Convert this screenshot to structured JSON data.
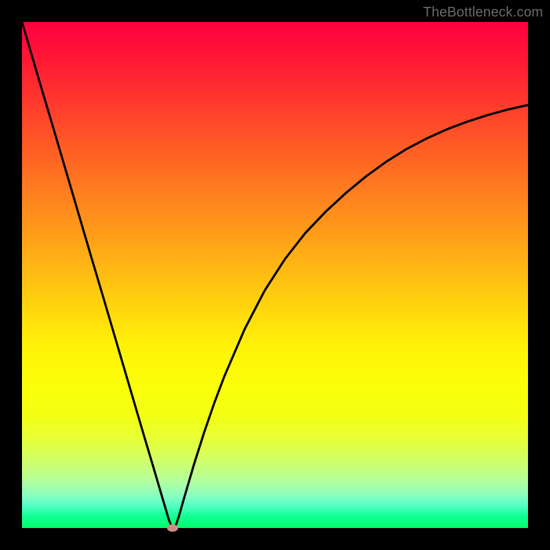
{
  "watermark": "TheBottleneck.com",
  "chart_data": {
    "type": "line",
    "title": "",
    "xlabel": "",
    "ylabel": "",
    "xlim": [
      0,
      1
    ],
    "ylim": [
      0,
      1
    ],
    "grid": false,
    "annotations": [],
    "gradient_meaning": "bottleneck severity (top=red=high, bottom=green=low)",
    "x": [
      0.0,
      0.02,
      0.04,
      0.06,
      0.08,
      0.1,
      0.12,
      0.14,
      0.16,
      0.18,
      0.2,
      0.22,
      0.24,
      0.26,
      0.28,
      0.285,
      0.29,
      0.295,
      0.3,
      0.305,
      0.31,
      0.32,
      0.34,
      0.36,
      0.38,
      0.4,
      0.44,
      0.48,
      0.52,
      0.56,
      0.6,
      0.64,
      0.68,
      0.72,
      0.76,
      0.8,
      0.84,
      0.88,
      0.92,
      0.96,
      1.0
    ],
    "y": [
      1.0,
      0.932,
      0.864,
      0.797,
      0.729,
      0.661,
      0.593,
      0.525,
      0.458,
      0.39,
      0.322,
      0.254,
      0.186,
      0.119,
      0.051,
      0.034,
      0.017,
      0.004,
      0.0,
      0.008,
      0.023,
      0.058,
      0.126,
      0.189,
      0.247,
      0.3,
      0.393,
      0.47,
      0.532,
      0.583,
      0.625,
      0.662,
      0.695,
      0.724,
      0.749,
      0.77,
      0.788,
      0.803,
      0.816,
      0.827,
      0.836
    ],
    "marker": {
      "x": 0.298,
      "y": 0.0
    },
    "series_color": "#000000",
    "marker_color": "#ce8b86"
  }
}
